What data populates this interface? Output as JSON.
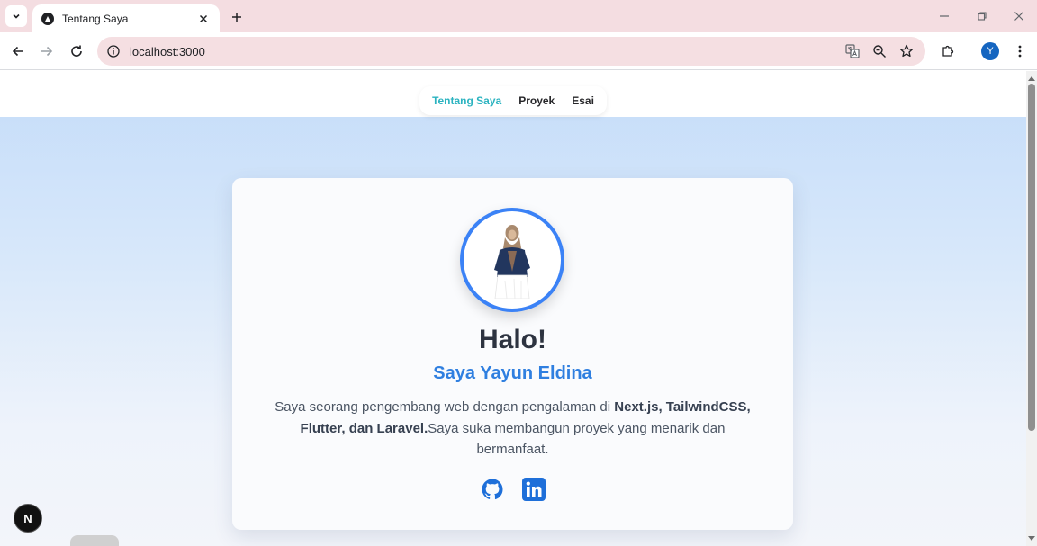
{
  "browser": {
    "tab_title": "Tentang Saya",
    "url": "localhost:3000",
    "profile_initial": "Y"
  },
  "site": {
    "nav": [
      {
        "label": "Tentang Saya",
        "active": true
      },
      {
        "label": "Proyek",
        "active": false
      },
      {
        "label": "Esai",
        "active": false
      }
    ],
    "greeting": "Halo!",
    "name": "Saya Yayun Eldina",
    "bio": {
      "intro": "Saya seorang pengembang web dengan pengalaman di ",
      "highlight": "Next.js, TailwindCSS, Flutter, dan Laravel.",
      "outro": "Saya suka membangun proyek yang menarik dan bermanfaat."
    },
    "socials": [
      {
        "icon": "github-icon"
      },
      {
        "icon": "linkedin-icon"
      }
    ],
    "next_badge": "N"
  },
  "colors": {
    "accent_blue": "#3b82f6",
    "name_blue": "#2f7fe0",
    "nav_active": "#2bb3c0",
    "tabstrip": "#f4dde1"
  }
}
